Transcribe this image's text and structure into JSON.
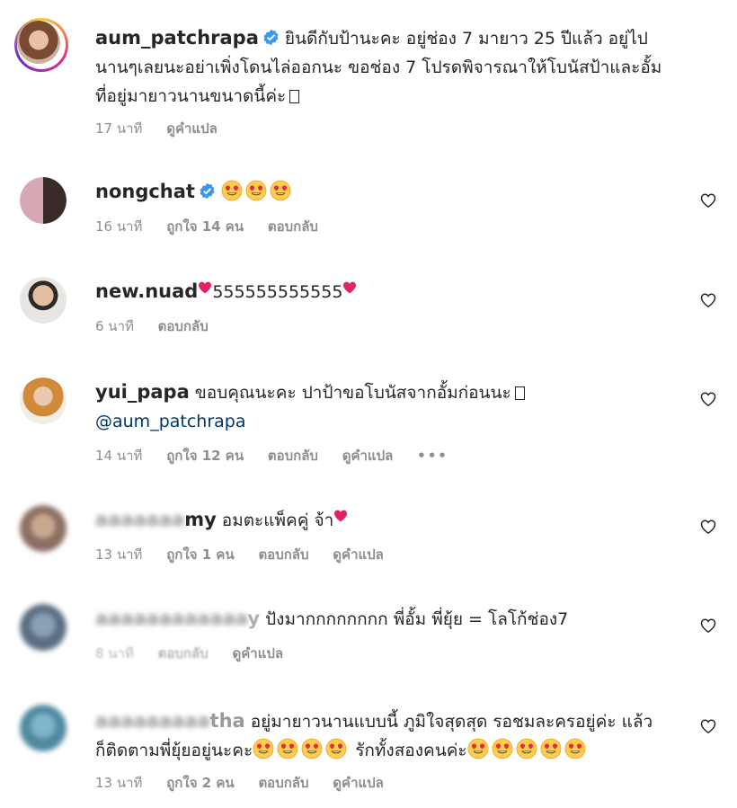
{
  "comments": [
    {
      "username": "aum_patchrapa",
      "verified": true,
      "text_lines": [
        "ยินดีกับป้านะคะ อยู่ช่อง 7 มายาว 25 ปีแล้ว อยู่ไป",
        "นานๆเลยนะอย่าเพิ่งโดนไล่ออกนะ ขอช่อง 7 โปรดพิจารณาให้โบนัสป้าและอั้ม",
        "ที่อยู่มายาวนานขนาดนี้ค่ะ"
      ],
      "time": "17 นาที",
      "translate": "ดูคำแปล"
    },
    {
      "username": "nongchat",
      "verified": true,
      "time": "16 นาที",
      "likes": "ถูกใจ 14 คน",
      "reply": "ตอบกลับ"
    },
    {
      "username": "new.nuad",
      "text": "555555555555",
      "time": "6 นาที",
      "reply": "ตอบกลับ"
    },
    {
      "username": "yui_papa",
      "text": "ขอบคุณนะคะ ปาป้าขอโบนัสจากอั้มก่อนนะ",
      "mention": "@aum_patchrapa",
      "time": "14 นาที",
      "likes": "ถูกใจ 12 คน",
      "reply": "ตอบกลับ",
      "translate": "ดูคำแปล",
      "more": "•••"
    },
    {
      "username_tail": "my",
      "text": "อมตะแพ็คคู่ จ้า",
      "time": "13 นาที",
      "likes": "ถูกใจ 1 คน",
      "reply": "ตอบกลับ",
      "translate": "ดูคำแปล"
    },
    {
      "username_tail": "y",
      "text": "ปังมากกกกกกกก พี่อั้ม พี่ยุ้ย = โลโก้ช่อง7",
      "time": "8 นาที",
      "reply": "ตอบกลับ",
      "translate": "ดูคำแปล"
    },
    {
      "username_tail": "tha",
      "text_line1": "อยู่มายาวนานแบบนี้ ภูมิใจสุดสุด รอชมละครอยู่ค่ะ แล้ว",
      "text_line2a": "ก็ติดตามพี่ยุ้ยอยู่นะคะ",
      "text_line2b": "รักทั้งสองคนค่ะ",
      "time": "13 นาที",
      "likes": "ถูกใจ 2 คน",
      "reply": "ตอบกลับ",
      "translate": "ดูคำแปล"
    }
  ],
  "icons": {
    "like": "heart-outline-icon",
    "verified": "verified-badge-icon",
    "emoji": "heart-eyes-emoji",
    "red_heart": "red-heart-emoji"
  },
  "colors": {
    "verified": "#3897f0",
    "meta": "#8e8e8e",
    "mention": "#00376b",
    "red_heart": "#e0245e"
  }
}
